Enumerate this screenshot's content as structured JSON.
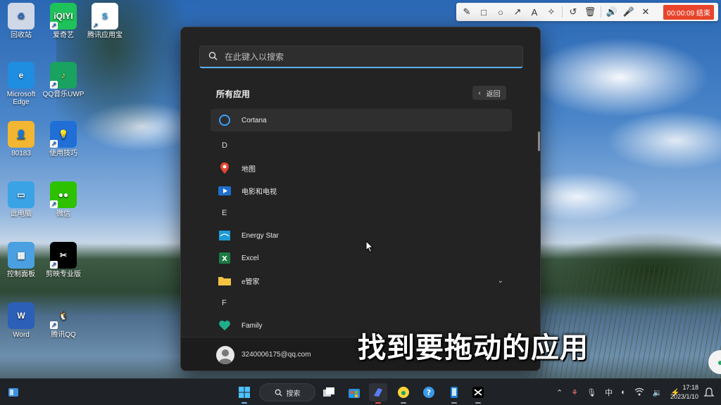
{
  "desktop": {
    "icons": [
      {
        "label": "回收站",
        "glyph": "♻",
        "bg": "#cfd8e6",
        "fg": "#2b6cc4",
        "shortcut": false,
        "pos": "col1-row1"
      },
      {
        "label": "爱奇艺",
        "glyph": "iQIYI",
        "bg": "#1ec15a",
        "fg": "#ffffff",
        "shortcut": true,
        "pos": "col2-row1"
      },
      {
        "label": "腾讯应用宝",
        "glyph": "S",
        "bg": "#ffffff",
        "fg": "#1a9bf0",
        "shortcut": true,
        "pos": "col3-row1"
      },
      {
        "label": "Microsoft Edge",
        "glyph": "e",
        "bg": "#1f8de0",
        "fg": "#ffffff",
        "shortcut": false,
        "pos": "col1-row2"
      },
      {
        "label": "QQ音乐UWP",
        "glyph": "♪",
        "bg": "#1aa260",
        "fg": "#ffd43b",
        "shortcut": true,
        "pos": "col2-row2"
      },
      {
        "label": "80183",
        "glyph": "👤",
        "bg": "#f2b632",
        "fg": "#7a4a00",
        "shortcut": false,
        "pos": "col1-row3"
      },
      {
        "label": "使用技巧",
        "glyph": "💡",
        "bg": "#1f6fd6",
        "fg": "#ffffff",
        "shortcut": true,
        "pos": "col2-row3"
      },
      {
        "label": "此电脑",
        "glyph": "▭",
        "bg": "#3aa3e6",
        "fg": "#ffffff",
        "shortcut": false,
        "pos": "col1-row4"
      },
      {
        "label": "微信",
        "glyph": "●●",
        "bg": "#2dc100",
        "fg": "#ffffff",
        "shortcut": true,
        "pos": "col2-row4"
      },
      {
        "label": "控制面板",
        "glyph": "▦",
        "bg": "#4aa0e0",
        "fg": "#ffffff",
        "shortcut": false,
        "pos": "col1-row5"
      },
      {
        "label": "剪映专业版",
        "glyph": "✂",
        "bg": "#000000",
        "fg": "#ffffff",
        "shortcut": true,
        "pos": "col2-row5"
      },
      {
        "label": "Word",
        "glyph": "W",
        "bg": "#2b5fb8",
        "fg": "#ffffff",
        "shortcut": false,
        "pos": "col1-row6"
      },
      {
        "label": "腾讯QQ",
        "glyph": "🐧",
        "bg": "transparent",
        "fg": "#000000",
        "shortcut": true,
        "pos": "col2-row6"
      }
    ]
  },
  "recorder": {
    "tools": [
      "✎",
      "□",
      "○",
      "↗",
      "A",
      "✧",
      "↺",
      "🗑",
      "🔊",
      "🎤",
      "✕"
    ],
    "timer": "00:00:09 结束"
  },
  "start_menu": {
    "search_placeholder": "在此键入以搜索",
    "section_title": "所有应用",
    "back_label": "返回",
    "apps": [
      {
        "type": "app",
        "name": "Cortana",
        "icon": "cortana-icon",
        "hover": true
      },
      {
        "type": "letter",
        "name": "D"
      },
      {
        "type": "app",
        "name": "地图",
        "icon": "maps-icon"
      },
      {
        "type": "app",
        "name": "电影和电视",
        "icon": "movies-tv-icon"
      },
      {
        "type": "letter",
        "name": "E"
      },
      {
        "type": "app",
        "name": "Energy Star",
        "icon": "energy-star-icon"
      },
      {
        "type": "app",
        "name": "Excel",
        "icon": "excel-icon"
      },
      {
        "type": "app",
        "name": "e管家",
        "icon": "folder-icon",
        "expand": true
      },
      {
        "type": "letter",
        "name": "F"
      },
      {
        "type": "app",
        "name": "Family",
        "icon": "family-icon"
      }
    ],
    "user_email": "3240006175@qq.com"
  },
  "caption": "找到要拖动的应用",
  "taskbar": {
    "search_label": "搜索",
    "tray_ime": "中",
    "time": "17:18",
    "date": "2023/1/10"
  },
  "colors": {
    "accent": "#5fb2f2",
    "menu_bg": "#232323",
    "timer_bg": "#e8442b"
  }
}
